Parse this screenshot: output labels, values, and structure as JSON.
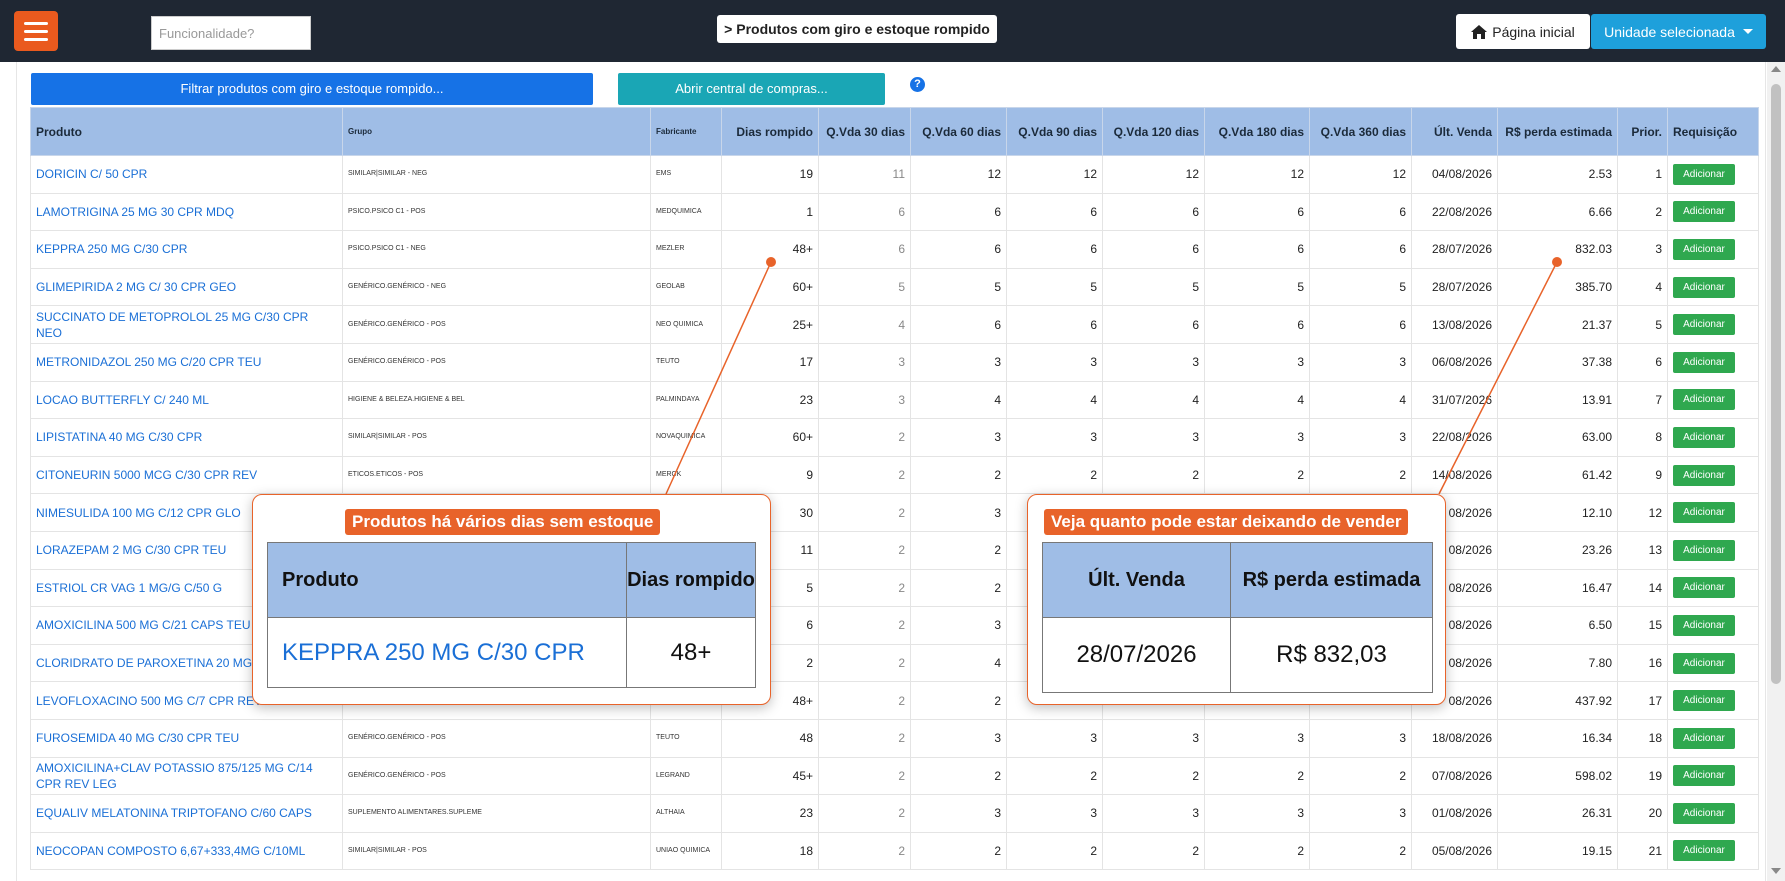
{
  "header": {
    "search_placeholder": "Funcionalidade?",
    "page_title": "> Produtos com giro e estoque rompido",
    "home_label": "Página inicial",
    "unit_label": "Unidade selecionada"
  },
  "toolbar": {
    "filter_label": "Filtrar produtos com giro e estoque rompido...",
    "compras_label": "Abrir central de compras...",
    "help_label": "?"
  },
  "table": {
    "columns": [
      "Produto",
      "Grupo",
      "Fabricante",
      "Dias rompido",
      "Q.Vda 30 dias",
      "Q.Vda 60 dias",
      "Q.Vda 90 dias",
      "Q.Vda 120 dias",
      "Q.Vda 180 dias",
      "Q.Vda 360 dias",
      "Últ. Venda",
      "R$ perda estimada",
      "Prior.",
      "Requisição"
    ],
    "add_label": "Adicionar",
    "rows": [
      [
        "DORICIN C/ 50 CPR",
        "SIMILAR|SIMILAR - NEG",
        "EMS",
        "19",
        "11",
        "12",
        "12",
        "12",
        "12",
        "12",
        "04/08/2026",
        "2.53",
        "1"
      ],
      [
        "LAMOTRIGINA 25 MG 30 CPR MDQ",
        "PSICO.PSICO C1 - POS",
        "MEDQUIMICA",
        "1",
        "6",
        "6",
        "6",
        "6",
        "6",
        "6",
        "22/08/2026",
        "6.66",
        "2"
      ],
      [
        "KEPPRA 250 MG C/30 CPR",
        "PSICO.PSICO C1 - NEG",
        "MEZLER",
        "48+",
        "6",
        "6",
        "6",
        "6",
        "6",
        "6",
        "28/07/2026",
        "832.03",
        "3"
      ],
      [
        "GLIMEPIRIDA 2 MG C/ 30 CPR GEO",
        "GENÉRICO.GENÉRICO - NEG",
        "GEOLAB",
        "60+",
        "5",
        "5",
        "5",
        "5",
        "5",
        "5",
        "28/07/2026",
        "385.70",
        "4"
      ],
      [
        "SUCCINATO DE METOPROLOL 25 MG C/30 CPR NEO",
        "GENÉRICO.GENÉRICO - POS",
        "NEO QUIMICA",
        "25+",
        "4",
        "6",
        "6",
        "6",
        "6",
        "6",
        "13/08/2026",
        "21.37",
        "5"
      ],
      [
        "METRONIDAZOL 250 MG C/20 CPR TEU",
        "GENÉRICO.GENÉRICO - POS",
        "TEUTO",
        "17",
        "3",
        "3",
        "3",
        "3",
        "3",
        "3",
        "06/08/2026",
        "37.38",
        "6"
      ],
      [
        "LOCAO BUTTERFLY C/ 240 ML",
        "HIGIENE & BELEZA.HIGIENE & BEL",
        "PALMINDAYA",
        "23",
        "3",
        "4",
        "4",
        "4",
        "4",
        "4",
        "31/07/2026",
        "13.91",
        "7"
      ],
      [
        "LIPISTATINA 40 MG C/30 CPR",
        "SIMILAR|SIMILAR - POS",
        "NOVAQUIMICA",
        "60+",
        "2",
        "3",
        "3",
        "3",
        "3",
        "3",
        "22/08/2026",
        "63.00",
        "8"
      ],
      [
        "CITONEURIN 5000 MCG C/30 CPR REV",
        "ETICOS.ETICOS - POS",
        "MERCK",
        "9",
        "2",
        "2",
        "2",
        "2",
        "2",
        "2",
        "14/08/2026",
        "61.42",
        "9"
      ],
      [
        "NIMESULIDA 100 MG C/12 CPR GLO",
        "",
        "",
        "30",
        "2",
        "3",
        "",
        "",
        "",
        "",
        "08/2026",
        "12.10",
        "12"
      ],
      [
        "LORAZEPAM 2 MG C/30 CPR TEU",
        "",
        "",
        "11",
        "2",
        "2",
        "",
        "",
        "",
        "",
        "08/2026",
        "23.26",
        "13"
      ],
      [
        "ESTRIOL CR VAG 1 MG/G C/50 G",
        "",
        "",
        "5",
        "2",
        "2",
        "",
        "",
        "",
        "",
        "08/2026",
        "16.47",
        "14"
      ],
      [
        "AMOXICILINA 500 MG C/21 CAPS TEU",
        "",
        "",
        "6",
        "2",
        "3",
        "",
        "",
        "",
        "",
        "08/2026",
        "6.50",
        "15"
      ],
      [
        "CLORIDRATO DE PAROXETINA 20 MG C/",
        "",
        "",
        "2",
        "2",
        "4",
        "",
        "",
        "",
        "",
        "08/2026",
        "7.80",
        "16"
      ],
      [
        "LEVOFLOXACINO 500 MG C/7 CPR REV",
        "",
        "",
        "48+",
        "2",
        "2",
        "",
        "",
        "",
        "",
        "08/2026",
        "437.92",
        "17"
      ],
      [
        "FUROSEMIDA 40 MG C/30 CPR TEU",
        "GENÉRICO.GENÉRICO - POS",
        "TEUTO",
        "48",
        "2",
        "3",
        "3",
        "3",
        "3",
        "3",
        "18/08/2026",
        "16.34",
        "18"
      ],
      [
        "AMOXICILINA+CLAV POTASSIO 875/125 MG C/14 CPR REV LEG",
        "GENÉRICO.GENÉRICO - POS",
        "LEGRAND",
        "45+",
        "2",
        "2",
        "2",
        "2",
        "2",
        "2",
        "07/08/2026",
        "598.02",
        "19"
      ],
      [
        "EQUALIV MELATONINA TRIPTOFANO C/60 CAPS",
        "SUPLEMENTO ALIMENTARES.SUPLEME",
        "ALTHAIA",
        "23",
        "2",
        "3",
        "3",
        "3",
        "3",
        "3",
        "01/08/2026",
        "26.31",
        "20"
      ],
      [
        "NEOCOPAN COMPOSTO 6,67+333,4MG C/10ML",
        "SIMILAR|SIMILAR - POS",
        "UNIAO QUIMICA",
        "18",
        "2",
        "2",
        "2",
        "2",
        "2",
        "2",
        "05/08/2026",
        "19.15",
        "21"
      ]
    ]
  },
  "callout_left": {
    "title": "Produtos há vários dias sem estoque",
    "col1": "Produto",
    "col2": "Dias rompido",
    "product": "KEPPRA 250 MG C/30 CPR",
    "days": "48+"
  },
  "callout_right": {
    "title": "Veja quanto pode estar deixando de vender",
    "col1": "Últ. Venda",
    "col2": "R$ perda estimada",
    "date": "28/07/2026",
    "loss": "R$ 832,03"
  },
  "colors": {
    "topbar": "#1f2733",
    "accent_orange": "#ea5a1e",
    "primary_blue": "#1672e6",
    "teal": "#1aa6b5",
    "unit_blue": "#1ea0db",
    "header_blue": "#9fbde6",
    "add_green": "#2fa84f",
    "link_blue": "#1a6fd6"
  }
}
